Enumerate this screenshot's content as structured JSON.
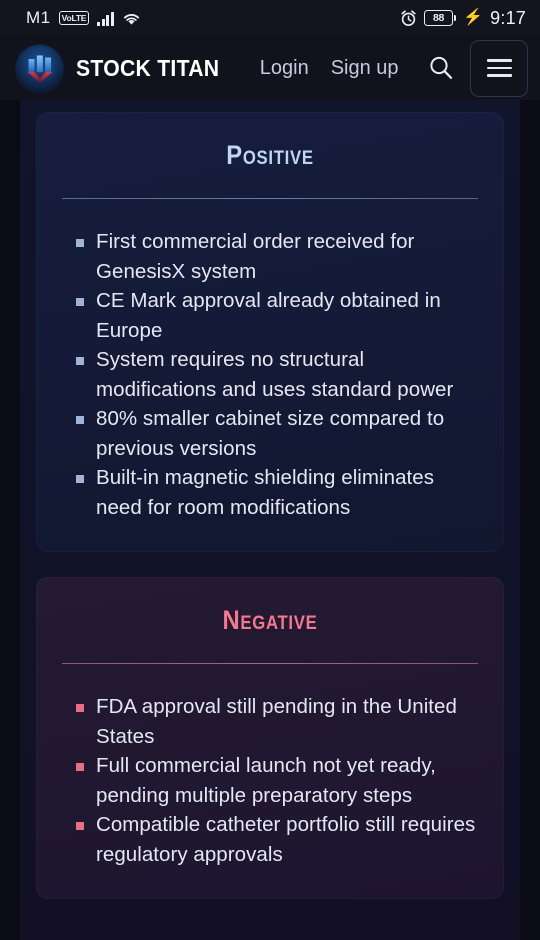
{
  "status_bar": {
    "carrier": "M1",
    "network_badge": "VoLTE",
    "signal_icon": "signal-bars-icon",
    "wifi_icon": "wifi-icon",
    "alarm_icon": "alarm-clock-icon",
    "battery_percent": "88",
    "charging_icon": "charging-bolt-icon",
    "time": "9:17"
  },
  "navbar": {
    "logo_icon": "stock-titan-logo-icon",
    "brand_name": "STOCK TITAN",
    "links": [
      {
        "label": "Login"
      },
      {
        "label": "Sign up"
      }
    ],
    "search_icon": "search-icon",
    "menu_icon": "hamburger-menu-icon"
  },
  "cards": [
    {
      "id": "positive",
      "title": "Positive",
      "accent_color": "#bfd5f6",
      "bullet_color": "#9fb4d6",
      "bullets": [
        "First commercial order received for GenesisX system",
        "CE Mark approval already obtained in Europe",
        "System requires no structural modifications and uses standard power",
        "80% smaller cabinet size compared to previous versions",
        "Built-in magnetic shielding eliminates need for room modifications"
      ]
    },
    {
      "id": "negative",
      "title": "Negative",
      "accent_color": "#f4788f",
      "bullet_color": "#e86f88",
      "bullets": [
        "FDA approval still pending in the United States",
        "Full commercial launch not yet ready, pending multiple preparatory steps",
        "Compatible catheter portfolio still requires regulatory approvals"
      ]
    }
  ]
}
